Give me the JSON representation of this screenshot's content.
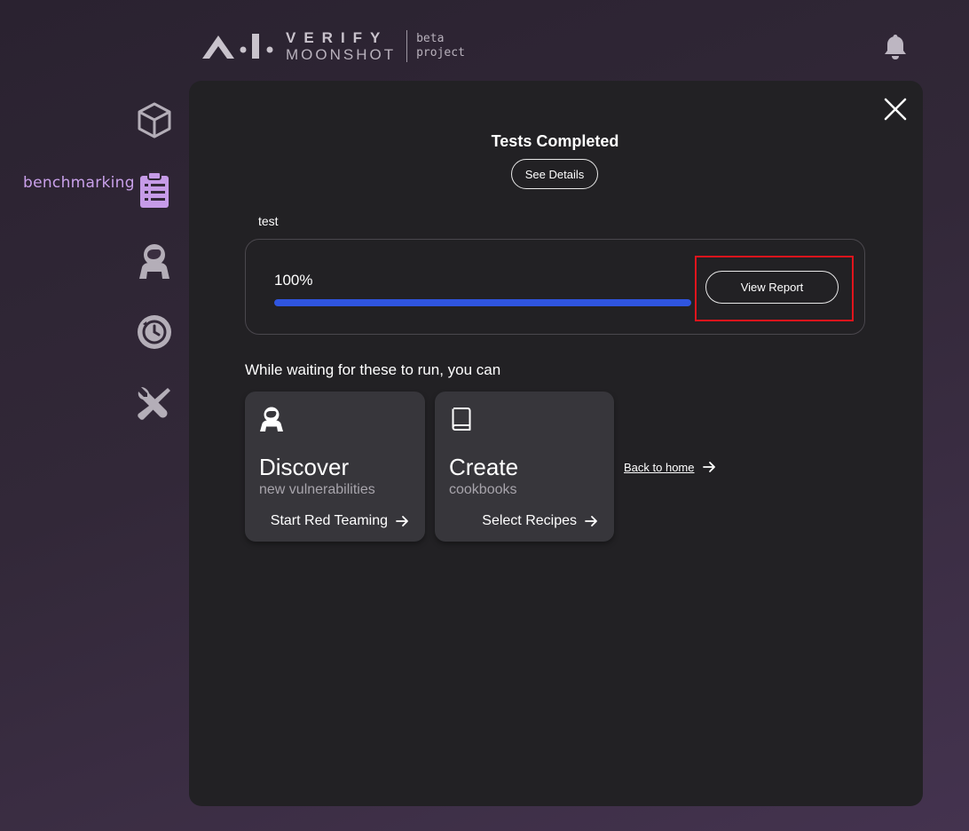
{
  "header": {
    "logo_line1": "VERIFY",
    "logo_line2": "MOONSHOT",
    "logo_tag1": "beta",
    "logo_tag2": "project",
    "bell_icon": "bell-icon"
  },
  "sidebar": {
    "active_label": "benchmarking",
    "active_color": "#c9a0ea",
    "items": [
      {
        "icon": "cube-icon"
      },
      {
        "icon": "clipboard-list-icon"
      },
      {
        "icon": "red-teaming-astronaut-icon"
      },
      {
        "icon": "history-icon"
      },
      {
        "icon": "tools-icon"
      }
    ]
  },
  "panel": {
    "title": "Tests Completed",
    "see_details_label": "See Details",
    "test_name": "test",
    "progress_text": "100%",
    "progress_value": 1.0,
    "progress_color": "#2f55e0",
    "view_report_label": "View Report",
    "waiting_text": "While waiting for these to run, you can",
    "cards": [
      {
        "icon": "astronaut-icon",
        "title": "Discover",
        "subtitle": "new vulnerabilities",
        "action": "Start Red Teaming"
      },
      {
        "icon": "book-icon",
        "title": "Create",
        "subtitle": "cookbooks",
        "action": "Select Recipes"
      }
    ],
    "back_home_label": "Back to home"
  }
}
